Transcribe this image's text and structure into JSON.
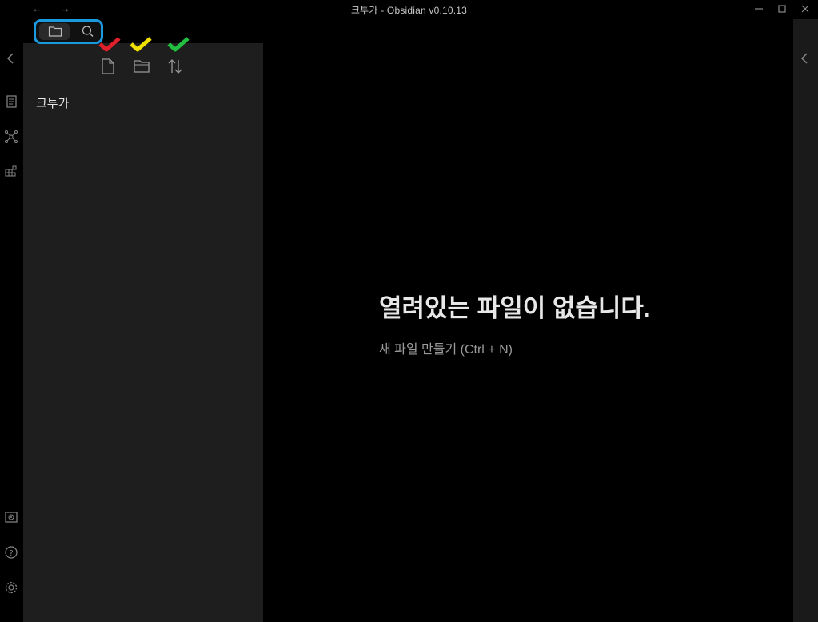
{
  "window": {
    "title": "크투가 - Obsidian v0.10.13"
  },
  "sidebar": {
    "tabs": [
      {
        "id": "file-explorer",
        "icon": "folder-icon",
        "active": true
      },
      {
        "id": "search",
        "icon": "search-icon",
        "active": false
      }
    ],
    "toolbar": [
      {
        "id": "new-note",
        "icon": "new-file-icon",
        "check_color": "#e0202a"
      },
      {
        "id": "new-folder",
        "icon": "new-folder-icon",
        "check_color": "#f0e000"
      },
      {
        "id": "sort",
        "icon": "sort-icon",
        "check_color": "#22c040"
      }
    ],
    "vault_name": "크투가"
  },
  "main": {
    "empty_title": "열려있는 파일이 없습니다.",
    "empty_action": "새 파일 만들기 (Ctrl + N)"
  },
  "colors": {
    "tab_highlight": "#1a9be0",
    "sidebar_bg": "#1e1e1e",
    "background": "#000000"
  }
}
